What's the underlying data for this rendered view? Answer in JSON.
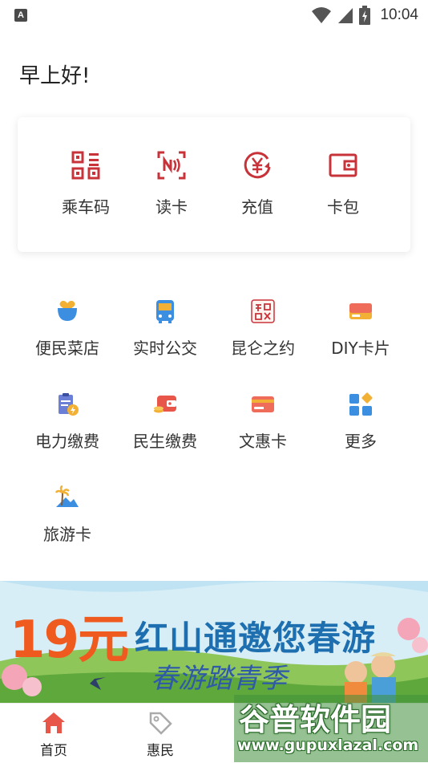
{
  "status_bar": {
    "time": "10:04",
    "left_icon": "A"
  },
  "greeting": "早上好!",
  "quick_actions": [
    {
      "label": "乘车码",
      "icon": "qr-code-icon"
    },
    {
      "label": "读卡",
      "icon": "nfc-icon"
    },
    {
      "label": "充值",
      "icon": "yuan-recharge-icon"
    },
    {
      "label": "卡包",
      "icon": "wallet-icon"
    }
  ],
  "services": [
    {
      "label": "便民菜店",
      "icon": "heart-basket-icon"
    },
    {
      "label": "实时公交",
      "icon": "bus-icon"
    },
    {
      "label": "昆仑之约",
      "icon": "seal-stamp-icon"
    },
    {
      "label": "DIY卡片",
      "icon": "card-icon"
    },
    {
      "label": "电力缴费",
      "icon": "electric-bill-icon"
    },
    {
      "label": "民生缴费",
      "icon": "wallet-coins-icon"
    },
    {
      "label": "文惠卡",
      "icon": "culture-card-icon"
    },
    {
      "label": "更多",
      "icon": "more-grid-icon"
    },
    {
      "label": "旅游卡",
      "icon": "travel-palm-icon"
    }
  ],
  "banner": {
    "big_text": "19元",
    "title": "红山通邀您春游",
    "subtitle": "春游踏青季"
  },
  "tabs": [
    {
      "label": "首页",
      "icon": "home-icon",
      "active": true
    },
    {
      "label": "惠民",
      "icon": "tag-icon",
      "active": false
    }
  ],
  "watermark": {
    "title": "谷普软件园",
    "url": "www.gupuxlazal.com"
  },
  "colors": {
    "accent": "#c8333a",
    "text": "#333333",
    "banner_orange": "#ef5a1e",
    "banner_blue": "#1e6fb0"
  }
}
